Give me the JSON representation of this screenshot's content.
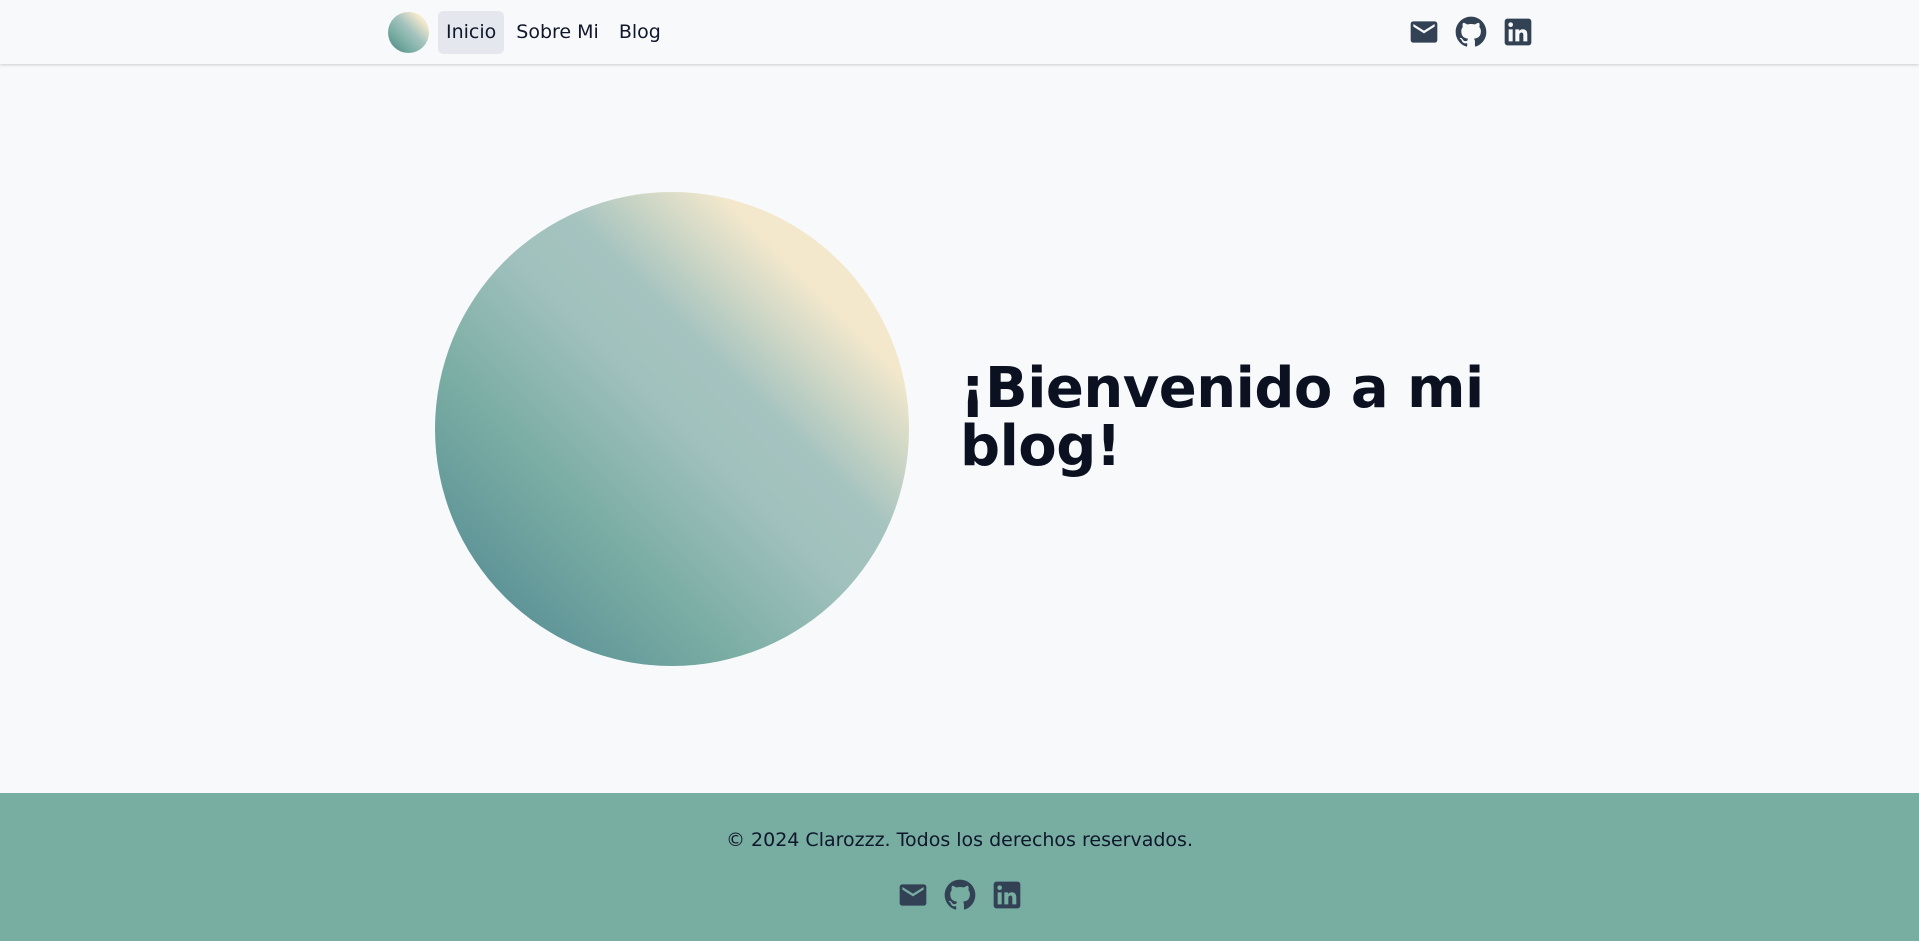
{
  "nav": {
    "logo": "logo-gradient-circle",
    "links": [
      {
        "label": "Inicio",
        "active": true
      },
      {
        "label": "Sobre Mi",
        "active": false
      },
      {
        "label": "Blog",
        "active": false
      }
    ],
    "social_icons": [
      "mail-icon",
      "github-icon",
      "linkedin-icon"
    ]
  },
  "hero": {
    "title": "¡Bienvenido a mi blog!"
  },
  "footer": {
    "copyright": "© 2024 Clarozzz. Todos los derechos reservados.",
    "social_icons": [
      "mail-icon",
      "github-icon",
      "linkedin-icon"
    ]
  },
  "colors": {
    "background": "#f8f9fb",
    "footer": "#78ada2",
    "icon": "#334155",
    "active_tab": "#e4e8ee",
    "gradient": [
      "#3f7682",
      "#7aada3",
      "#a3c2be",
      "#f3e8cc"
    ]
  }
}
